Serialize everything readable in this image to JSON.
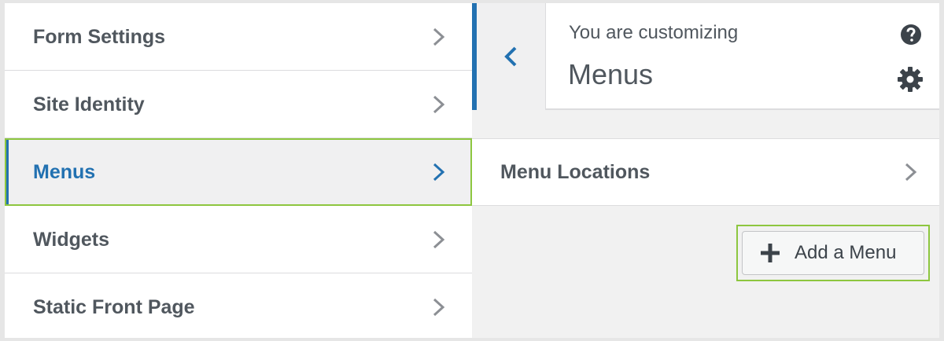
{
  "left_panel": {
    "items": [
      {
        "label": "Form Settings",
        "active": false
      },
      {
        "label": "Site Identity",
        "active": false
      },
      {
        "label": "Menus",
        "active": true
      },
      {
        "label": "Widgets",
        "active": false
      },
      {
        "label": "Static Front Page",
        "active": false
      }
    ]
  },
  "header": {
    "customizing_label": "You are customizing",
    "title": "Menus",
    "help_icon": "help-icon",
    "gear_icon": "gear-icon",
    "back_icon": "chevron-left-icon"
  },
  "section": {
    "menu_locations_label": "Menu Locations"
  },
  "actions": {
    "add_menu_label": "Add a Menu"
  },
  "colors": {
    "accent": "#2271b1",
    "highlight": "#8dc63f",
    "text": "#50575e"
  }
}
